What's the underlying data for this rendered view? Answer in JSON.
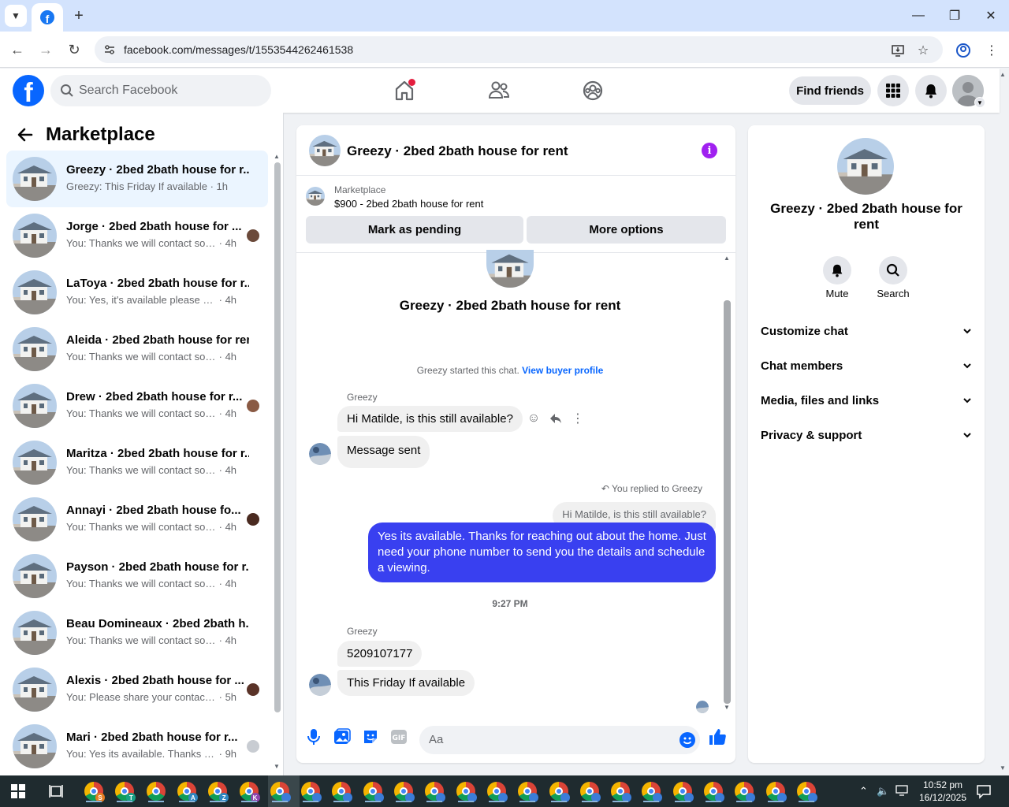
{
  "browser": {
    "url": "facebook.com/messages/t/1553544262461538",
    "new_tab": "+",
    "window_controls": [
      "minimize",
      "maximize",
      "close"
    ]
  },
  "fb_header": {
    "logo": "f",
    "search_placeholder": "Search Facebook",
    "find_friends": "Find friends",
    "icons": [
      "home-icon",
      "friends-icon",
      "groups-icon",
      "menu-grid-icon",
      "notifications-icon",
      "profile-avatar"
    ]
  },
  "sidebar": {
    "title": "Marketplace",
    "conversations": [
      {
        "name": "Greezy · 2bed 2bath house for r...",
        "snippet": "Greezy: This Friday If available",
        "time": "1h",
        "active": true,
        "read_avatar": ""
      },
      {
        "name": "Jorge · 2bed 2bath house for ...",
        "snippet": "You: Thanks we will contact soo...",
        "time": "4h",
        "active": false,
        "read_avatar": "#6b4a3a"
      },
      {
        "name": "LaToya · 2bed 2bath house for r...",
        "snippet": "You: Yes, it's available please drop y...",
        "time": "4h",
        "active": false,
        "read_avatar": ""
      },
      {
        "name": "Aleida · 2bed 2bath house for rent",
        "snippet": "You: Thanks we will contact soon w...",
        "time": "4h",
        "active": false,
        "read_avatar": ""
      },
      {
        "name": "Drew · 2bed 2bath house for r...",
        "snippet": "You: Thanks we will contact soo...",
        "time": "4h",
        "active": false,
        "read_avatar": "#8a5a44"
      },
      {
        "name": "Maritza · 2bed 2bath house for r...",
        "snippet": "You: Thanks we will contact soon w...",
        "time": "4h",
        "active": false,
        "read_avatar": ""
      },
      {
        "name": "Annayi · 2bed 2bath house fo...",
        "snippet": "You: Thanks we will contact soo...",
        "time": "4h",
        "active": false,
        "read_avatar": "#4a2a20"
      },
      {
        "name": "Payson · 2bed 2bath house for r...",
        "snippet": "You: Thanks we will contact soon w...",
        "time": "4h",
        "active": false,
        "read_avatar": ""
      },
      {
        "name": "Beau Domineaux · 2bed 2bath h...",
        "snippet": "You: Thanks we will contact soon w...",
        "time": "4h",
        "active": false,
        "read_avatar": ""
      },
      {
        "name": "Alexis · 2bed 2bath house for ...",
        "snippet": "You: Please share your contact n...",
        "time": "5h",
        "active": false,
        "read_avatar": "#5a3328"
      },
      {
        "name": "Mari · 2bed 2bath house for r...",
        "snippet": "You: Yes its available. Thanks for ...",
        "time": "9h",
        "active": false,
        "read_avatar": "#c8ccd2"
      }
    ]
  },
  "chat": {
    "title": "Greezy · 2bed 2bath house for rent",
    "marketplace_label": "Marketplace",
    "listing": "$900 - 2bed 2bath house for rent",
    "mark_pending": "Mark as pending",
    "more_options": "More options",
    "intro_title": "Greezy · 2bed 2bath house for rent",
    "system_text": "Greezy started this chat.",
    "system_link": "View buyer profile",
    "sender": "Greezy",
    "msg1": "Hi Matilde, is this still available?",
    "msg2": "Message sent",
    "replied_label": "You replied to Greezy",
    "quoted": "Hi Matilde, is this still available?",
    "reply": "Yes its available. Thanks for reaching out about the home. Just need your phone number to send you the details and schedule a viewing.",
    "timestamp": "9:27 PM",
    "sender2": "Greezy",
    "msg3": "5209107177",
    "msg4": "This Friday If available",
    "composer_placeholder": "Aa"
  },
  "info_panel": {
    "title": "Greezy · 2bed 2bath house for rent",
    "mute": "Mute",
    "search": "Search",
    "sections": [
      "Customize chat",
      "Chat members",
      "Media, files and links",
      "Privacy & support"
    ]
  },
  "taskbar": {
    "time": "10:52 pm",
    "date": "16/12/2025",
    "badges": [
      {
        "letter": "S",
        "color": "#e67e22"
      },
      {
        "letter": "T",
        "color": "#16a085"
      },
      {
        "letter": "",
        "color": ""
      },
      {
        "letter": "A",
        "color": "#2e86c1"
      },
      {
        "letter": "Z",
        "color": "#2e86c1"
      },
      {
        "letter": "K",
        "color": "#8e44ad"
      }
    ],
    "profile_apps_count": 18
  },
  "colors": {
    "fb_blue": "#0866ff",
    "outgoing_bubble": "#3940f0",
    "info_icon": "#a020f0",
    "notification_dot": "#e41e3f"
  }
}
